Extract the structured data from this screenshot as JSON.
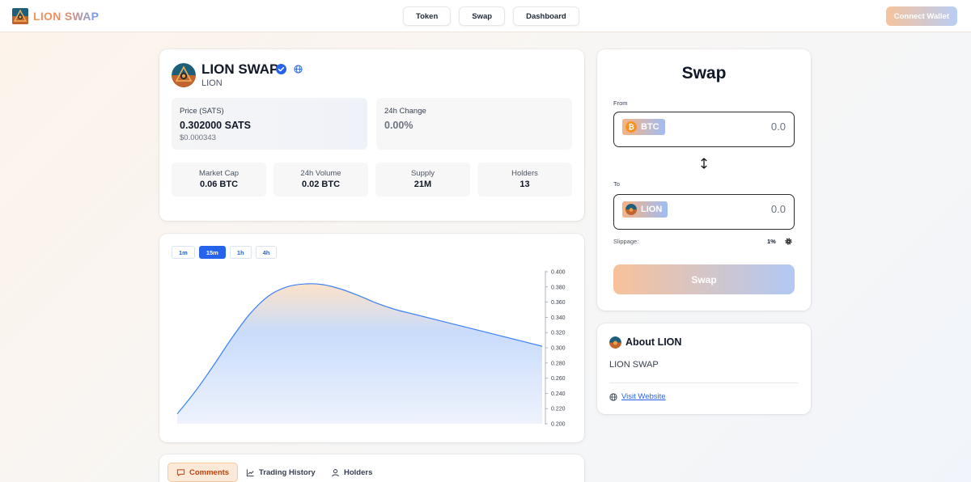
{
  "header": {
    "brand": "LION SWAP",
    "nav": [
      "Token",
      "Swap",
      "Dashboard"
    ],
    "connect_label": "Connect Wallet"
  },
  "token": {
    "name": "LION SWAP",
    "symbol": "LION",
    "price_label": "Price (SATS)",
    "price_value": "0.302000 SATS",
    "price_usd": "$0.000343",
    "change_label": "24h Change",
    "change_value": "0.00%",
    "stats": [
      {
        "label": "Market Cap",
        "value": "0.06 BTC"
      },
      {
        "label": "24h Volume",
        "value": "0.02 BTC"
      },
      {
        "label": "Supply",
        "value": "21M"
      },
      {
        "label": "Holders",
        "value": "13"
      }
    ]
  },
  "chart": {
    "timeframes": [
      "1m",
      "15m",
      "1h",
      "4h"
    ],
    "active_timeframe": "15m"
  },
  "chart_data": {
    "type": "area",
    "title": "",
    "xlabel": "",
    "ylabel": "",
    "ylim": [
      0.2,
      0.4
    ],
    "y_ticks": [
      "0.400",
      "0.380",
      "0.360",
      "0.340",
      "0.320",
      "0.300",
      "0.280",
      "0.260",
      "0.240",
      "0.220",
      "0.200"
    ],
    "x": [
      0,
      1,
      2,
      3,
      4,
      5,
      6,
      7,
      8,
      9,
      10,
      11,
      12,
      13,
      14,
      15,
      16,
      17,
      18,
      19,
      20
    ],
    "values": [
      0.213,
      0.243,
      0.277,
      0.313,
      0.345,
      0.368,
      0.38,
      0.384,
      0.383,
      0.377,
      0.368,
      0.358,
      0.35,
      0.344,
      0.338,
      0.332,
      0.326,
      0.32,
      0.314,
      0.308,
      0.302
    ],
    "grid": false,
    "line_color": "#3b82f6"
  },
  "tabs": [
    {
      "label": "Comments",
      "icon": "comment-icon"
    },
    {
      "label": "Trading History",
      "icon": "chart-line-icon"
    },
    {
      "label": "Holders",
      "icon": "user-icon"
    }
  ],
  "swap": {
    "title": "Swap",
    "from_label": "From",
    "from_token": "BTC",
    "from_amount": "0.0",
    "to_label": "To",
    "to_token": "LION",
    "to_amount": "0.0",
    "slippage_label": "Slippage:",
    "slippage_value": "1%",
    "button_label": "Swap"
  },
  "about": {
    "title": "About LION",
    "description": "LION SWAP",
    "link_label": "Visit Website"
  },
  "colors": {
    "accent_blue": "#2563eb",
    "accent_orange": "#f2955a",
    "verified": "#2563eb"
  }
}
